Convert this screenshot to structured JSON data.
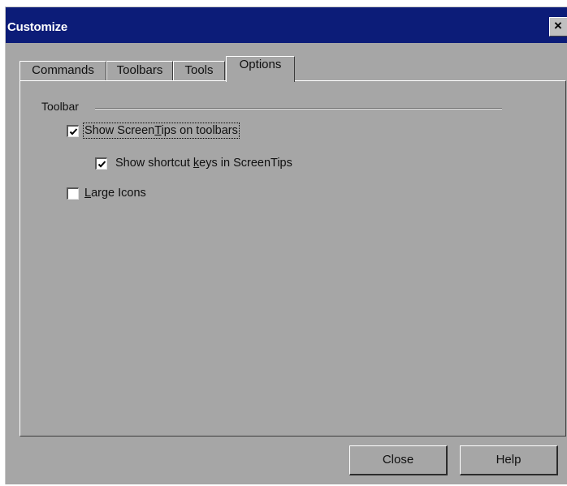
{
  "window": {
    "title": "Customize",
    "close_glyph": "×"
  },
  "tabs": [
    {
      "label": "Commands",
      "active": false
    },
    {
      "label": "Toolbars",
      "active": false
    },
    {
      "label": "Tools",
      "active": false
    },
    {
      "label": "Options",
      "active": true
    }
  ],
  "toolbar_group": {
    "label": "Toolbar",
    "options": [
      {
        "pre": "Show Screen",
        "mnemonic": "T",
        "post": "ips on toolbars",
        "checked": true
      },
      {
        "pre": "Show shortcut ",
        "mnemonic": "k",
        "post": "eys in ScreenTips",
        "checked": true
      },
      {
        "pre": "",
        "mnemonic": "L",
        "post": "arge Icons",
        "checked": false
      }
    ]
  },
  "buttons": {
    "close_label": "Close",
    "help_label": "Help"
  },
  "icons": {
    "check": "check-icon",
    "close": "close-icon"
  }
}
